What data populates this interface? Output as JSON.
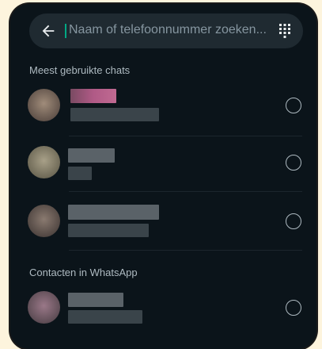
{
  "search": {
    "placeholder": "Naam of telefoonnummer zoeken..."
  },
  "sections": {
    "frequent": "Meest gebruikte chats",
    "contacts": "Contacten in WhatsApp"
  },
  "colors": {
    "background": "#0b141a",
    "search_bg": "#1f2a31",
    "accent": "#00a884",
    "muted_text": "#8696a0"
  },
  "icons": {
    "back": "arrow-left-icon",
    "dialpad": "dialpad-icon",
    "select": "radio-unchecked-icon"
  }
}
